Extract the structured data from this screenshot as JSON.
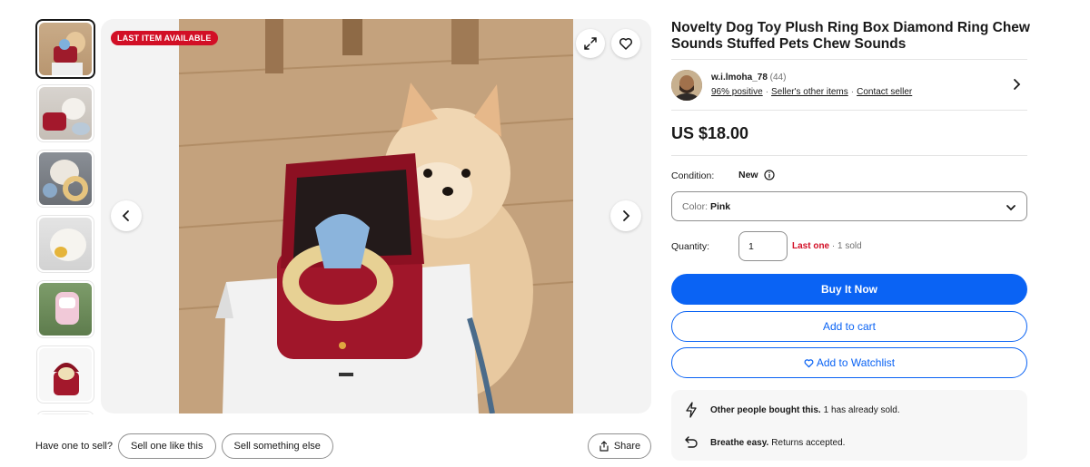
{
  "gallery": {
    "badge": "LAST ITEM AVAILABLE",
    "thumbnails": [
      {
        "alt": "dog with ring box"
      },
      {
        "alt": "white dog with red ring box"
      },
      {
        "alt": "ring toy"
      },
      {
        "alt": "dog with yellow ring"
      },
      {
        "alt": "pink ring box"
      },
      {
        "alt": "red ring box with ring"
      }
    ]
  },
  "sell": {
    "label": "Have one to sell?",
    "sell_one": "Sell one like this",
    "sell_other": "Sell something else"
  },
  "share": {
    "label": "Share"
  },
  "product": {
    "title": "Novelty Dog Toy Plush Ring Box Diamond Ring Chew Sounds Stuffed Pets Chew Sounds",
    "price": "US $18.00"
  },
  "seller": {
    "name": "w.i.lmoha_78",
    "count": "(44)",
    "positive": "96% positive",
    "other_items": "Seller's other items",
    "contact": "Contact seller"
  },
  "condition": {
    "label": "Condition:",
    "value": "New"
  },
  "color_select": {
    "label": "Color:",
    "value": "Pink"
  },
  "quantity": {
    "label": "Quantity:",
    "value": "1",
    "last_one": "Last one",
    "sold": "· 1 sold"
  },
  "buttons": {
    "buy_now": "Buy It Now",
    "add_cart": "Add to cart",
    "watchlist": "Add to Watchlist"
  },
  "info": {
    "bought_bold": "Other people bought this.",
    "bought_text": "1 has already sold.",
    "easy_bold": "Breathe easy.",
    "easy_text": "Returns accepted."
  },
  "colors": {
    "accent": "#0a63f4",
    "badge": "#d20f26",
    "text": "#191919"
  }
}
